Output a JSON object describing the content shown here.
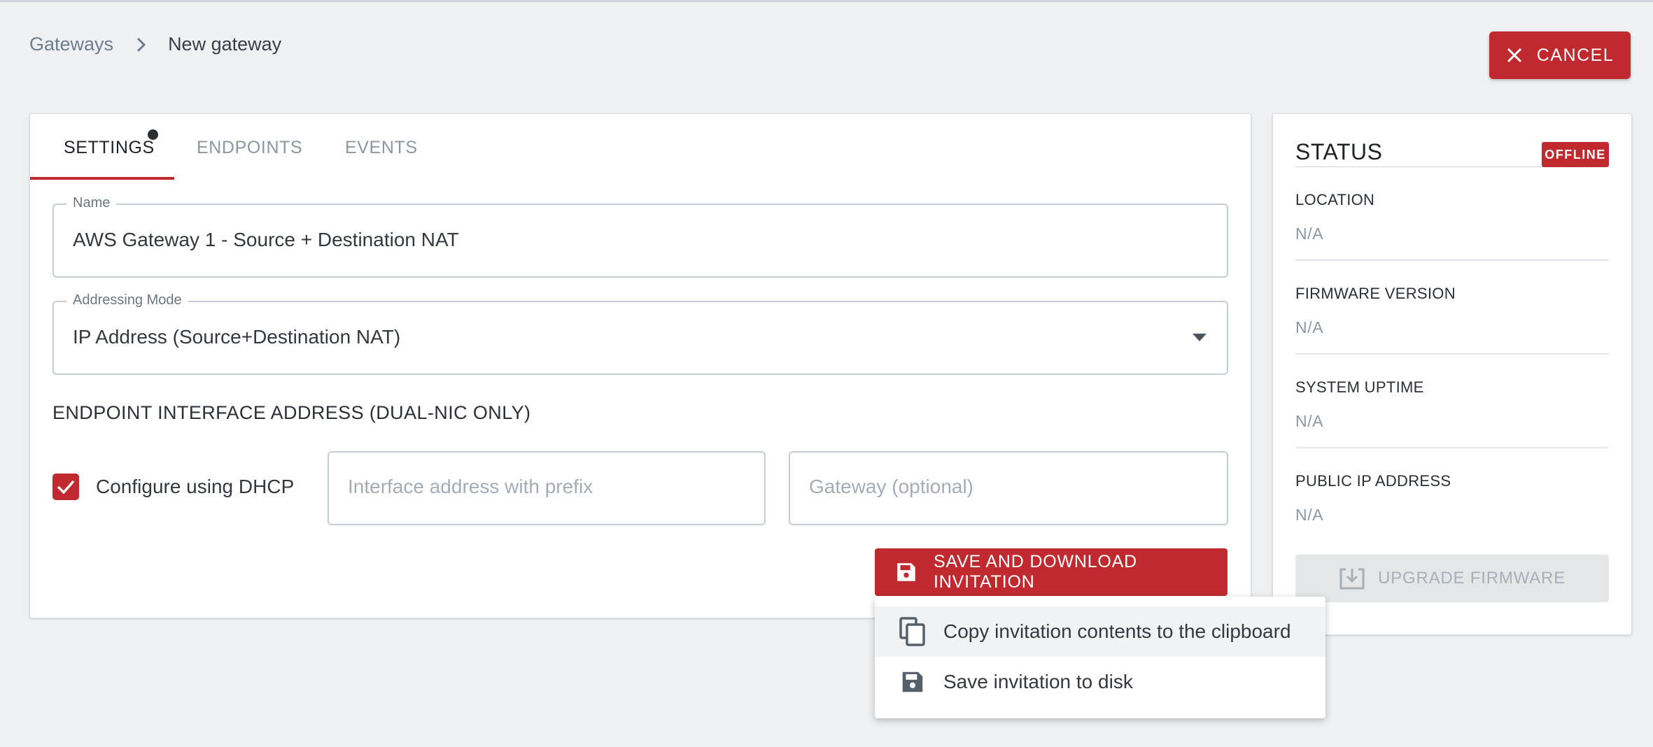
{
  "breadcrumb": {
    "parent": "Gateways",
    "current": "New gateway"
  },
  "header": {
    "cancel_label": "CANCEL"
  },
  "tabs": [
    {
      "label": "SETTINGS",
      "active": true,
      "has_unsaved_indicator": true
    },
    {
      "label": "ENDPOINTS",
      "active": false
    },
    {
      "label": "EVENTS",
      "active": false
    }
  ],
  "form": {
    "name": {
      "label": "Name",
      "value": "AWS Gateway 1 - Source + Destination NAT"
    },
    "addressing_mode": {
      "label": "Addressing Mode",
      "value": "IP Address (Source+Destination NAT)"
    },
    "endpoint_section_title": "ENDPOINT INTERFACE ADDRESS (DUAL-NIC ONLY)",
    "dhcp": {
      "label": "Configure using DHCP",
      "checked": true
    },
    "interface_address": {
      "placeholder": "Interface address with prefix",
      "value": ""
    },
    "gateway": {
      "placeholder": "Gateway (optional)",
      "value": ""
    },
    "save_button_label": "SAVE AND DOWNLOAD INVITATION"
  },
  "save_menu": {
    "items": [
      {
        "label": "Copy invitation contents to the clipboard",
        "icon": "copy-icon"
      },
      {
        "label": "Save invitation to disk",
        "icon": "floppy-disk-icon"
      }
    ]
  },
  "status": {
    "title": "STATUS",
    "badge": "OFFLINE",
    "fields": [
      {
        "label": "LOCATION",
        "value": "N/A"
      },
      {
        "label": "FIRMWARE VERSION",
        "value": "N/A"
      },
      {
        "label": "SYSTEM UPTIME",
        "value": "N/A"
      },
      {
        "label": "PUBLIC IP ADDRESS",
        "value": "N/A"
      }
    ],
    "upgrade_button_label": "UPGRADE FIRMWARE"
  },
  "colors": {
    "accent": "#c0292e",
    "background": "#eef0f2",
    "muted_text": "#8b96a1"
  }
}
